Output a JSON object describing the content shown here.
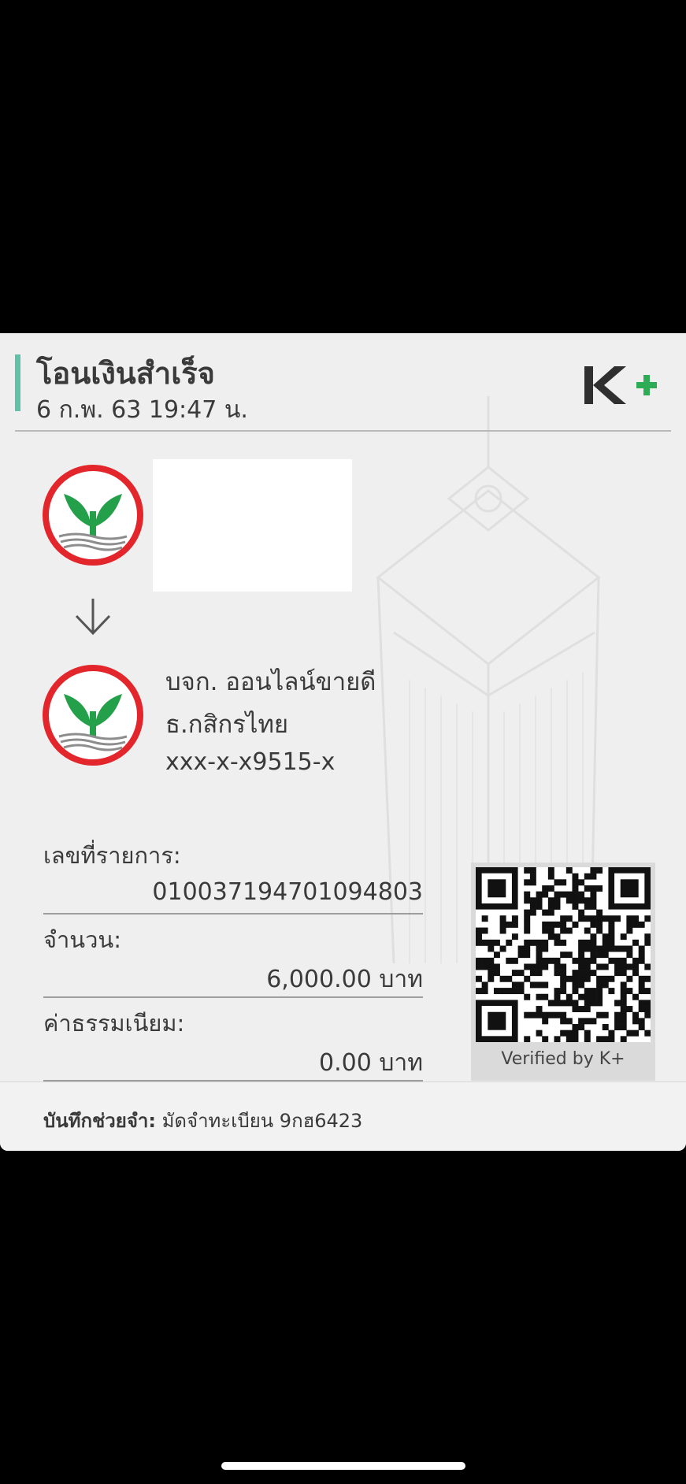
{
  "slip": {
    "title": "โอนเงินสำเร็จ",
    "datetime": "6 ก.พ. 63  19:47 น.",
    "brand": "K+"
  },
  "receiver": {
    "name": "บจก. ออนไลน์ขายดี",
    "bank": "ธ.กสิกรไทย",
    "account": "xxx-x-x9515-x"
  },
  "fields": {
    "ref_label": "เลขที่รายการ:",
    "ref_value": "010037194701094803",
    "amount_label": "จำนวน:",
    "amount_value": "6,000.00 บาท",
    "fee_label": "ค่าธรรมเนียม:",
    "fee_value": "0.00 บาท"
  },
  "qr": {
    "caption": "Verified by K+"
  },
  "memo": {
    "label": "บันทึกช่วยจำ:",
    "value": "มัดจำทะเบียน 9กฮ6423"
  },
  "colors": {
    "accent_bar": "#5fc2a8",
    "kbank_red": "#e2262b",
    "kbank_green": "#25a04a",
    "kplus_dark": "#2f2f2f",
    "kplus_green": "#2dab55"
  }
}
